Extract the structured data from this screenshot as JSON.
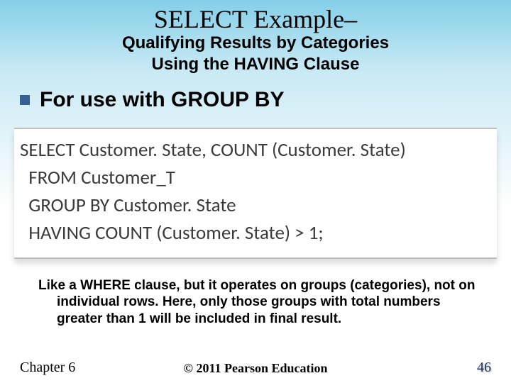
{
  "title": "SELECT Example–",
  "subtitle_line1": "Qualifying Results by Categories",
  "subtitle_line2": "Using the HAVING Clause",
  "bullet": "For use with GROUP BY",
  "code": {
    "l1": "SELECT Customer. State, COUNT (Customer. State)",
    "l2": "  FROM Customer_T",
    "l3": "  GROUP BY Customer. State",
    "l4": "  HAVING COUNT (Customer. State) > 1;"
  },
  "explain": "Like a WHERE clause, but it operates on groups (categories), not on individual rows. Here, only those groups with total numbers greater than 1 will be included in final result.",
  "footer": {
    "chapter": "Chapter 6",
    "copyright": "© 2011 Pearson Education",
    "page": "46"
  }
}
